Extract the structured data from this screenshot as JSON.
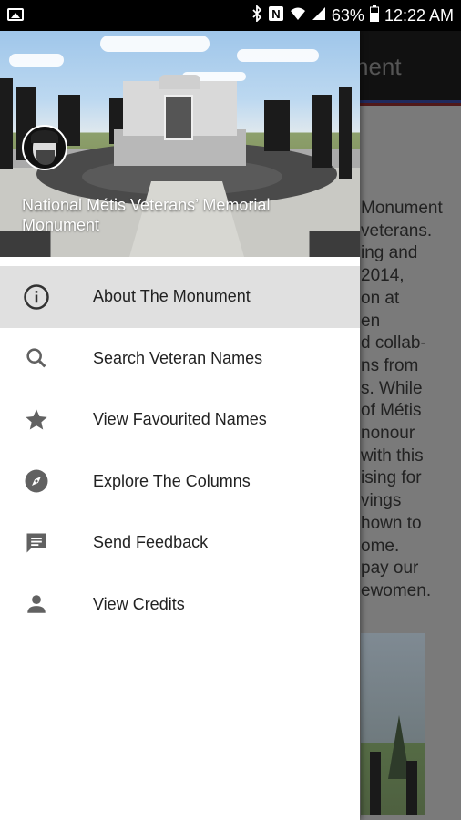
{
  "status_bar": {
    "battery": "63%",
    "time": "12:22 AM"
  },
  "background_app": {
    "toolbar_title_fragment": "nent",
    "text_lines": [
      "Monument",
      " veterans.",
      "ing and",
      "2014,",
      "on at",
      "en",
      "d collab-",
      "ns from",
      "s. While",
      "of Métis",
      "nonour",
      "with this",
      "ising for",
      "vings",
      "hown to",
      "ome.",
      "pay our",
      "ewomen."
    ]
  },
  "drawer": {
    "header_title": "National Métis Veterans’ Memorial Monument",
    "items": [
      {
        "label": "About The Monument",
        "icon": "info-icon",
        "active": true
      },
      {
        "label": "Search Veteran Names",
        "icon": "search-icon",
        "active": false
      },
      {
        "label": "View Favourited Names",
        "icon": "star-icon",
        "active": false
      },
      {
        "label": "Explore The Columns",
        "icon": "compass-icon",
        "active": false
      },
      {
        "label": "Send Feedback",
        "icon": "feedback-icon",
        "active": false
      },
      {
        "label": "View Credits",
        "icon": "person-icon",
        "active": false
      }
    ]
  },
  "colors": {
    "active_item_bg": "#e0e0e0",
    "icon_gray": "#616161",
    "text": "#222222"
  }
}
